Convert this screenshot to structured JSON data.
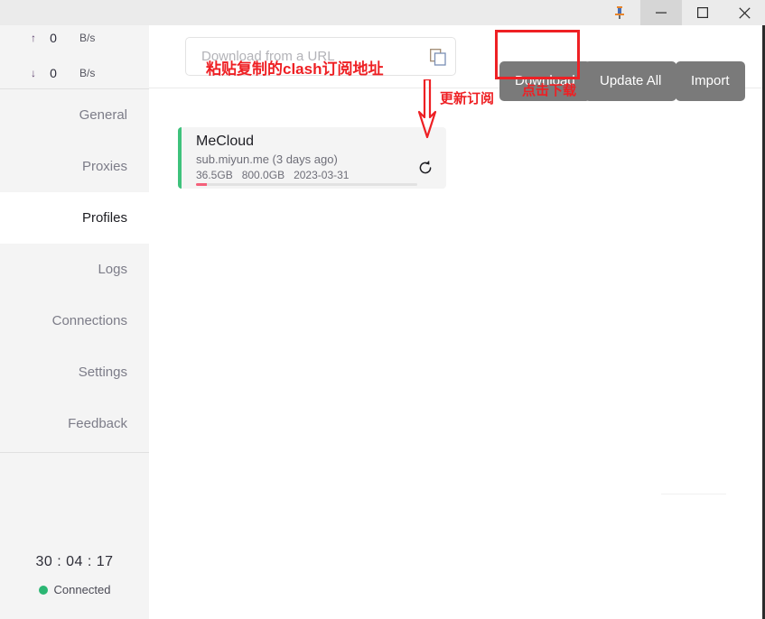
{
  "window": {
    "controls": [
      {
        "name": "pin-icon",
        "label": "Pin"
      },
      {
        "name": "minimize-icon",
        "label": "Minimize"
      },
      {
        "name": "maximize-icon",
        "label": "Maximize"
      },
      {
        "name": "close-icon",
        "label": "Close"
      }
    ]
  },
  "sidebar": {
    "speed": {
      "upload": {
        "arrow": "↑",
        "value": "0",
        "unit": "B/s"
      },
      "download": {
        "arrow": "↓",
        "value": "0",
        "unit": "B/s"
      }
    },
    "items": [
      {
        "label": "General",
        "active": false
      },
      {
        "label": "Proxies",
        "active": false
      },
      {
        "label": "Profiles",
        "active": true
      },
      {
        "label": "Logs",
        "active": false
      },
      {
        "label": "Connections",
        "active": false
      },
      {
        "label": "Settings",
        "active": false
      },
      {
        "label": "Feedback",
        "active": false
      }
    ],
    "status": {
      "timer": "30 : 04 : 17",
      "connection": "Connected",
      "connection_color": "#2bb673"
    }
  },
  "toolbar": {
    "url_placeholder": "Download from a URL",
    "url_value": "",
    "copy_icon": "copy-icon",
    "download_label": "Download",
    "update_all_label": "Update All",
    "import_label": "Import",
    "button_color": "#7a7a7a"
  },
  "profiles": [
    {
      "name": "MeCloud",
      "source": "sub.miyun.me (3 days ago)",
      "used": "36.5GB",
      "total": "800.0GB",
      "expire": "2023-03-31",
      "progress_percent": 5,
      "accent_color": "#3ec27c",
      "progress_color": "#f4607a"
    }
  ],
  "annotations": {
    "color": "#ee2024",
    "paste_url": "粘贴复制的clash订阅地址",
    "click_download": "点击下载",
    "update_subscription": "更新订阅"
  }
}
